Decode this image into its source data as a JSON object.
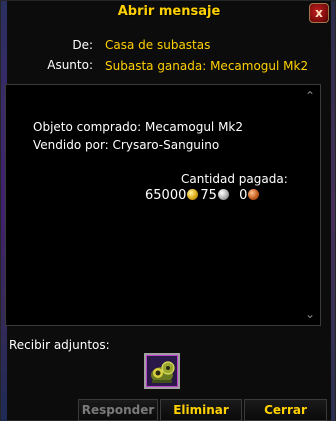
{
  "window": {
    "title": "Abrir mensaje",
    "close_glyph": "x"
  },
  "header": {
    "from_label": "De:",
    "from_value": "Casa de subastas",
    "subject_label": "Asunto:",
    "subject_value": "Subasta ganada: Mecamogul Mk2"
  },
  "message": {
    "line1": "Objeto comprado: Mecamogul Mk2",
    "line2": "Vendido por: Crysaro-Sanguino",
    "paid_label": "Cantidad pagada:",
    "gold": "65000",
    "silver": "75",
    "copper": "0"
  },
  "scroll": {
    "up_glyph": "⌃",
    "down_glyph": "⌄"
  },
  "attachments": {
    "label": "Recibir adjuntos:",
    "items": [
      {
        "icon": "mechanical-mount-icon"
      }
    ]
  },
  "buttons": {
    "reply": "Responder",
    "delete": "Eliminar",
    "close": "Cerrar"
  },
  "colors": {
    "title": "#ffd100",
    "value": "#ffd100",
    "disabled": "#7a7a7a"
  }
}
